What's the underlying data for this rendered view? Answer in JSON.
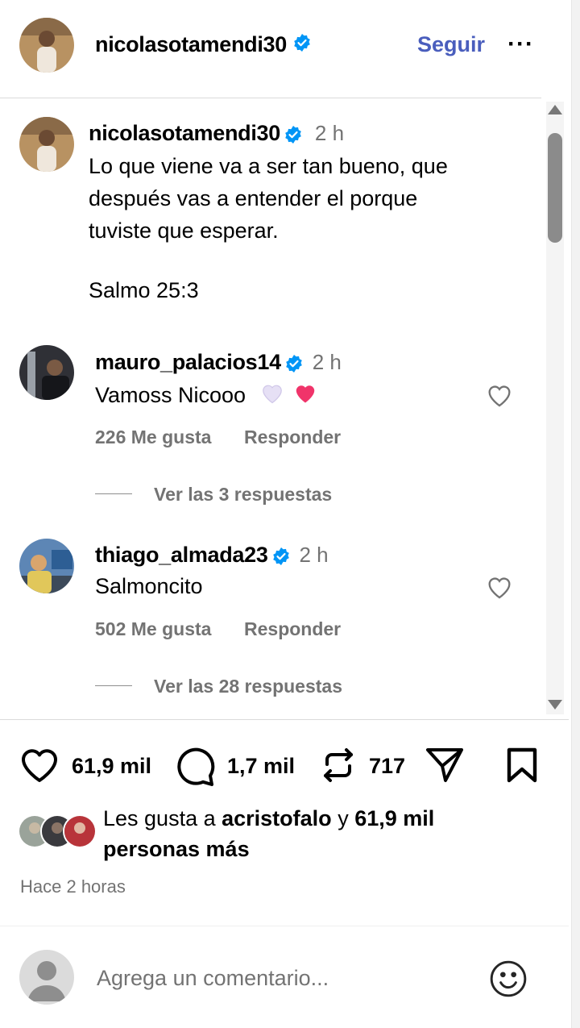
{
  "header": {
    "username": "nicolasotamendi30",
    "follow_label": "Seguir",
    "more_label": "···"
  },
  "caption": {
    "username": "nicolasotamendi30",
    "time": "2 h",
    "lines": [
      "Lo que viene va a ser tan bueno, que",
      "después vas a entender el porque",
      "tuviste que esperar."
    ],
    "verse": "Salmo 25:3"
  },
  "comments": [
    {
      "username": "mauro_palacios14",
      "time": "2 h",
      "text": "Vamoss Nicooo",
      "likes": "226 Me gusta",
      "reply_label": "Responder",
      "view_replies": "Ver las 3 respuestas"
    },
    {
      "username": "thiago_almada23",
      "time": "2 h",
      "text": "Salmoncito",
      "likes": "502 Me gusta",
      "reply_label": "Responder",
      "view_replies": "Ver las 28 respuestas"
    }
  ],
  "actions": {
    "likes": "61,9 mil",
    "comments": "1,7 mil",
    "reposts": "717"
  },
  "liked_by": {
    "prefix": "Les gusta a",
    "user": "acristofalo",
    "connector": "y",
    "rest_line1": "61,9 mil",
    "rest_line2": "personas más"
  },
  "timestamp": "Hace 2 horas",
  "add_comment": {
    "placeholder": "Agrega un comentario..."
  },
  "colors": {
    "verified": "#0095f6",
    "follow": "#4a5ebd",
    "secondary_text": "#737373",
    "heart_emoji": "#f0346a",
    "white_heart": "#e6e0f5"
  }
}
